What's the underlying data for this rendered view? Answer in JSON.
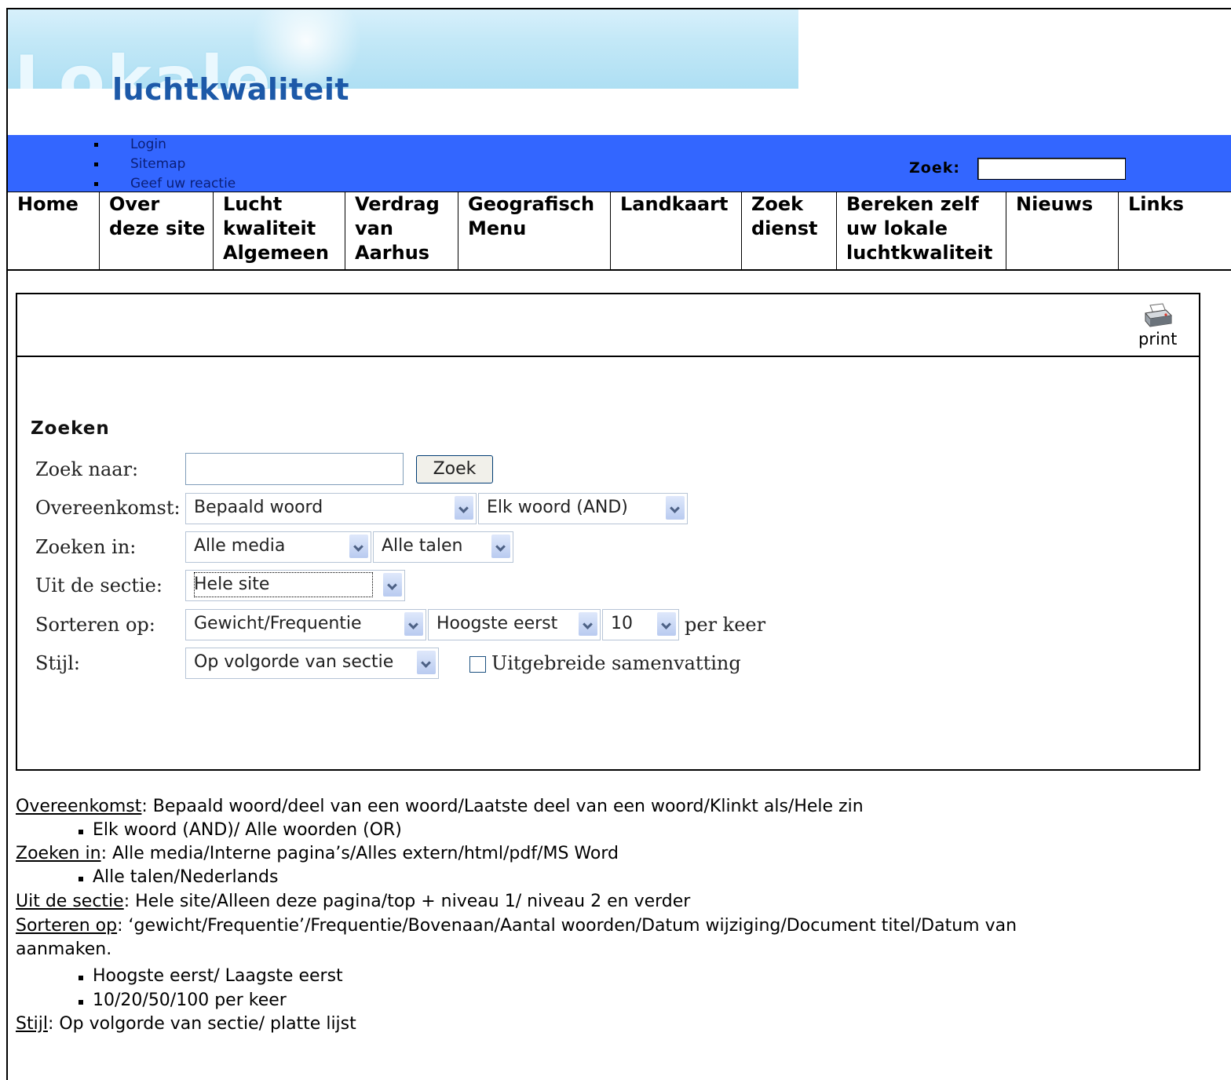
{
  "banner": {
    "logo_top": "Lokale",
    "logo_bottom": "luchtkwaliteit"
  },
  "toplinks": [
    "Login",
    "Sitemap",
    "Geef uw reactie"
  ],
  "search_header": {
    "label": "Zoek:",
    "value": ""
  },
  "nav": [
    "Home",
    "Over deze site",
    "Lucht kwaliteit Algemeen",
    "Verdrag van Aarhus",
    "Geografisch Menu",
    "Landkaart",
    "Zoek dienst",
    "Bereken zelf uw lokale luchtkwaliteit",
    "Nieuws",
    "Links"
  ],
  "print": {
    "label": "print",
    "icon": "printer-icon"
  },
  "form": {
    "title": "Zoeken",
    "labels": {
      "zoek_naar": "Zoek naar:",
      "overeenkomst": "Overeenkomst:",
      "zoeken_in": "Zoeken in:",
      "uit_de_sectie": "Uit de sectie:",
      "sorteren_op": "Sorteren op:",
      "stijl": "Stijl:"
    },
    "search_value": "",
    "search_button": "Zoek",
    "overeenkomst_1": "Bepaald woord",
    "overeenkomst_2": "Elk woord (AND)",
    "zoeken_in_1": "Alle media",
    "zoeken_in_2": "Alle talen",
    "sectie": "Hele site",
    "sorteren_1": "Gewicht/Frequentie",
    "sorteren_2": "Hoogste eerst",
    "sorteren_3": "10",
    "per_keer": "per keer",
    "stijl": "Op volgorde van sectie",
    "uitgebreid_label": "Uitgebreide samenvatting",
    "uitgebreid_checked": false
  },
  "notes": {
    "overeenkomst_term": "Overeenkomst",
    "overeenkomst_text": ": Bepaald woord/deel van een woord/Laatste deel van een woord/Klinkt als/Hele zin",
    "overeenkomst_sub": "Elk woord (AND)/ Alle woorden (OR)",
    "zoeken_in_term": "Zoeken in",
    "zoeken_in_text": ": Alle media/Interne pagina’s/Alles extern/html/pdf/MS Word",
    "zoeken_in_sub": "Alle talen/Nederlands",
    "sectie_term": "Uit de sectie",
    "sectie_text": ": Hele site/Alleen deze pagina/top + niveau 1/ niveau 2 en verder",
    "sorteren_term": "Sorteren op",
    "sorteren_text": ": ‘gewicht/Frequentie’/Frequentie/Bovenaan/Aantal woorden/Datum wijziging/Document titel/Datum van",
    "sorteren_text2": "aanmaken.",
    "sorteren_sub1": "Hoogste eerst/ Laagste eerst",
    "sorteren_sub2": "10/20/50/100 per keer",
    "stijl_term": "Stijl",
    "stijl_text": ": Op volgorde van sectie/ platte lijst"
  }
}
